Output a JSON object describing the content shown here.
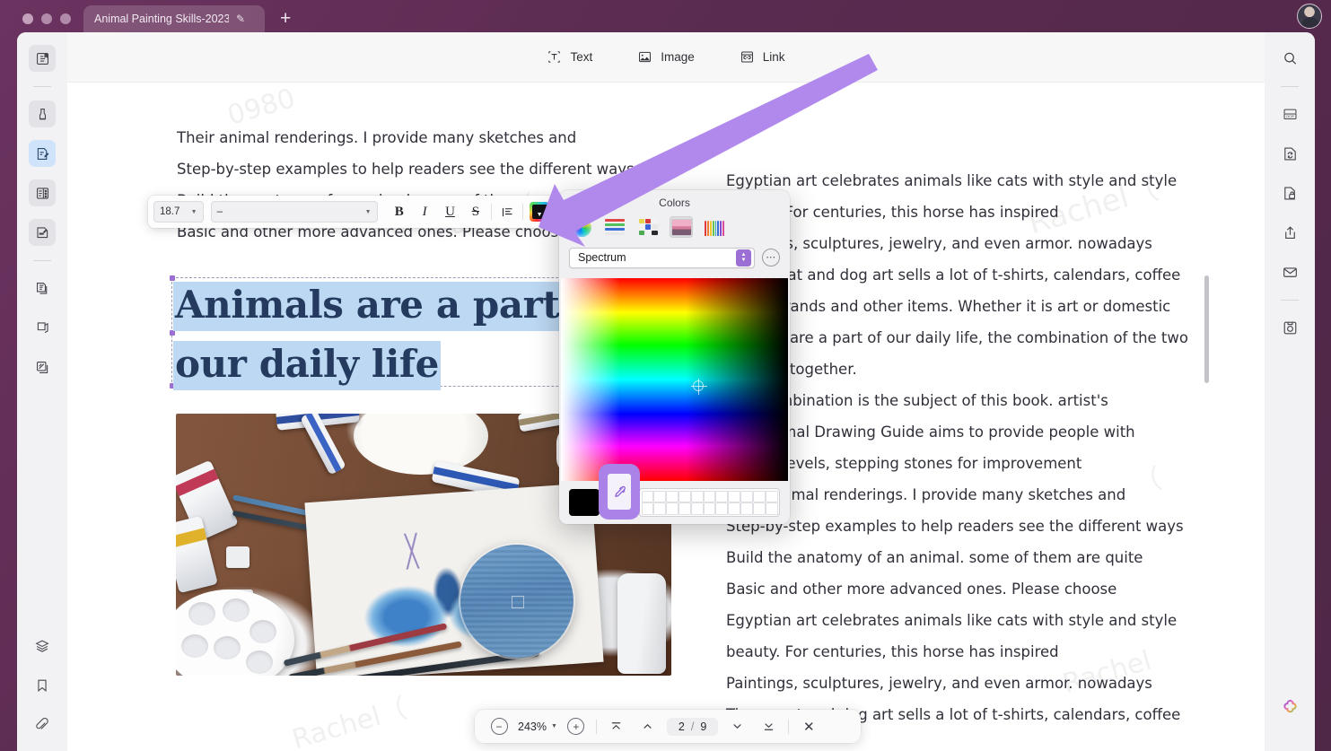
{
  "window": {
    "tab_title": "Animal Painting Skills-2023",
    "tab_edit_icon": "pencil-icon",
    "new_tab_label": "+",
    "avatar_label": "user-avatar"
  },
  "toolbar": {
    "items": [
      {
        "label": "Text",
        "icon": "text-box-icon"
      },
      {
        "label": "Image",
        "icon": "image-icon"
      },
      {
        "label": "Link",
        "icon": "link-icon"
      }
    ]
  },
  "left_rail": {
    "items": [
      {
        "icon": "reader-view-icon",
        "name": "sidebar-reader"
      },
      {
        "icon": "highlighter-icon",
        "name": "sidebar-highlight"
      },
      {
        "icon": "edit-document-icon",
        "name": "sidebar-edit",
        "active": true
      },
      {
        "icon": "annotate-icon",
        "name": "sidebar-annotate"
      },
      {
        "icon": "sign-icon",
        "name": "sidebar-sign"
      },
      {
        "icon": "page-copy-icon",
        "name": "sidebar-organize"
      },
      {
        "icon": "crop-icon",
        "name": "sidebar-crop"
      },
      {
        "icon": "compare-icon",
        "name": "sidebar-compare"
      }
    ],
    "bottom_items": [
      {
        "icon": "layers-icon",
        "name": "sidebar-layers"
      },
      {
        "icon": "bookmark-icon",
        "name": "sidebar-bookmark"
      },
      {
        "icon": "attachment-icon",
        "name": "sidebar-attachment"
      }
    ]
  },
  "right_rail": {
    "items": [
      {
        "icon": "search-icon",
        "name": "right-search"
      },
      {
        "icon": "ocr-icon",
        "name": "right-ocr"
      },
      {
        "icon": "convert-icon",
        "name": "right-convert"
      },
      {
        "icon": "protect-icon",
        "name": "right-protect"
      },
      {
        "icon": "share-icon",
        "name": "right-share"
      },
      {
        "icon": "email-icon",
        "name": "right-email"
      },
      {
        "icon": "save-icon",
        "name": "right-save"
      }
    ],
    "ai_icon": "ai-flower-icon"
  },
  "format_toolbar": {
    "font_size": "18.7",
    "font_family": "–",
    "bold": "B",
    "italic": "I",
    "underline": "U",
    "strikethrough": "S",
    "align_icon": "align-left-icon",
    "color_button": "text-color-icon"
  },
  "colors_panel": {
    "title": "Colors",
    "tabs": [
      {
        "icon": "color-wheel-icon",
        "name": "tab-color-wheel",
        "selected": false
      },
      {
        "icon": "color-sliders-icon",
        "name": "tab-color-sliders",
        "selected": false
      },
      {
        "icon": "color-palette-icon",
        "name": "tab-color-palette",
        "selected": false
      },
      {
        "icon": "image-palette-icon",
        "name": "tab-image-palette",
        "selected": true
      },
      {
        "icon": "crayons-icon",
        "name": "tab-crayons",
        "selected": false
      }
    ],
    "mode_select": "Spectrum",
    "more_options": "⋯",
    "current_color": "#000000",
    "eyedropper_icon": "eyedropper-icon",
    "swatch_columns": 11,
    "swatch_rows": 2
  },
  "document": {
    "heading_line1": "Animals are a part of",
    "heading_line2": "our daily life",
    "left_column": [
      "Their animal renderings. I provide many sketches and",
      "Step-by-step examples to help readers see the different ways",
      "Build the anatomy of an animal. some of them are quite",
      "Basic and other more advanced ones. Please choose"
    ],
    "right_column": [
      "Egyptian art celebrates animals like cats with style and style",
      "beauty. For centuries, this horse has inspired",
      "Paintings, sculptures, jewelry, and even armor. nowadays",
      "Times, cat and dog art sells a lot of t-shirts, calendars, coffee",
      "Mugs, brands and other items. Whether it is art or domestic",
      "Animals are a part of our daily life, the combination of the two",
      "Belongs together.",
      "This combination is the subject of this book. artist's",
      "The Animal Drawing Guide aims to provide people with",
      "All skill levels, stepping stones for improvement",
      "Their animal renderings. I provide many sketches and",
      "Step-by-step examples to help readers see the different ways",
      "Build the anatomy of an animal. some of them are quite",
      "Basic and other more advanced ones. Please choose",
      "Egyptian art celebrates animals like cats with style and style",
      "beauty. For centuries, this horse has inspired",
      "Paintings, sculptures, jewelry, and even armor. nowadays",
      "Times, cat and dog art sells a lot of t-shirts, calendars, coffee"
    ],
    "image_alt": "artist-desk-butterfly-painting",
    "watermark": "Rachel"
  },
  "bottom_bar": {
    "zoom_out": "−",
    "zoom_level": "243%",
    "zoom_in": "+",
    "first_page_icon": "first-page-icon",
    "prev_page_icon": "prev-page-icon",
    "current_page": "2",
    "page_separator": "/",
    "total_pages": "9",
    "next_page_icon": "next-page-icon",
    "last_page_icon": "last-page-icon",
    "close": "✕"
  },
  "annotation": {
    "arrow_color": "#b188ec",
    "name": "pointer-arrow"
  }
}
